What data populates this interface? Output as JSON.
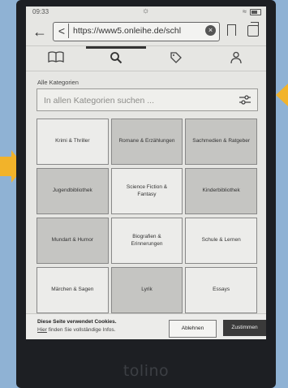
{
  "status": {
    "time": "09:33"
  },
  "browser": {
    "url": "https://www5.onleihe.de/schl",
    "back_label": "←",
    "chevron_label": "<",
    "clear_label": "×"
  },
  "nav_tabs": [
    "book-icon",
    "search-icon",
    "tag-icon",
    "person-icon"
  ],
  "search": {
    "section_label": "Alle Kategorien",
    "placeholder": "In allen Kategorien suchen ..."
  },
  "categories": [
    {
      "label": "Krimi & Thriller",
      "dark": false
    },
    {
      "label": "Romane & Erzählungen",
      "dark": true
    },
    {
      "label": "Sachmedien & Ratgeber",
      "dark": true
    },
    {
      "label": "Jugendbibliothek",
      "dark": true
    },
    {
      "label": "Science Fiction & Fantasy",
      "dark": false
    },
    {
      "label": "Kinderbibliothek",
      "dark": true
    },
    {
      "label": "Mundart & Humor",
      "dark": true
    },
    {
      "label": "Biografien & Erinnerungen",
      "dark": false
    },
    {
      "label": "Schule & Lernen",
      "dark": false
    },
    {
      "label": "Märchen & Sagen",
      "dark": false
    },
    {
      "label": "Lyrik",
      "dark": true
    },
    {
      "label": "Essays",
      "dark": false
    }
  ],
  "cookie": {
    "title": "Diese Seite verwendet Cookies.",
    "link": "Hier",
    "info_rest": " finden Sie vollständige Infos.",
    "decline": "Ablehnen",
    "accept": "Zustimmen"
  },
  "device": {
    "brand": "tolino"
  },
  "colors": {
    "background": "#8fb2d4",
    "arrow": "#f2b32a",
    "screen": "#e6e6e3",
    "accept": "#3a3a3a"
  }
}
